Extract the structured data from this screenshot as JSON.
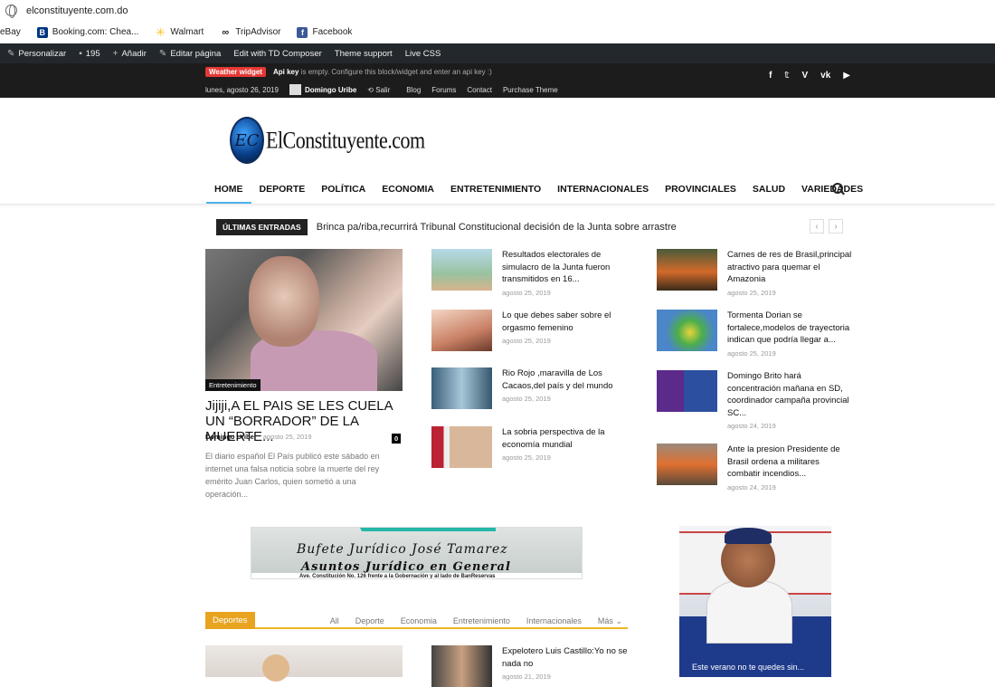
{
  "browser": {
    "url": "elconstituyente.com.do",
    "bookmarks": [
      {
        "label": "eBay",
        "icon": "ebay-icon"
      },
      {
        "label": "Booking.com: Chea...",
        "icon": "booking-icon",
        "color": "#003580"
      },
      {
        "label": "Walmart",
        "icon": "walmart-icon",
        "color": "#ffc220"
      },
      {
        "label": "TripAdvisor",
        "icon": "tripadvisor-icon"
      },
      {
        "label": "Facebook",
        "icon": "facebook-icon",
        "color": "#3b5998"
      }
    ]
  },
  "adminbar": {
    "customize": "Personalizar",
    "comments": "195",
    "add_new": "Añadir",
    "edit_page": "Editar página",
    "td_composer": "Edit with TD Composer",
    "theme_support": "Theme support",
    "live_css": "Live CSS"
  },
  "topbar": {
    "weather_tag": "Weather widget",
    "weather_bold": "Api key",
    "weather_msg": "is empty. Configure this block/widget and enter an api key :)",
    "date": "lunes, agosto 26, 2019",
    "user": "Domingo Uribe",
    "logout": "Salir",
    "menu": [
      "Blog",
      "Forums",
      "Contact",
      "Purchase Theme"
    ],
    "social": [
      "f",
      "t",
      "v",
      "vk",
      "yt"
    ]
  },
  "header": {
    "logo_mark": "EC",
    "logo_text": "ElConstituyente.com",
    "nav": [
      "HOME",
      "DEPORTE",
      "POLÍTICA",
      "ECONOMIA",
      "ENTRETENIMIENTO",
      "INTERNACIONALES",
      "PROVINCIALES",
      "SALUD",
      "VARIEDADES"
    ]
  },
  "ticker": {
    "label": "ÚLTIMAS ENTRADAS",
    "text": "Brinca pa/riba,recurrirá Tribunal Constitucional decisión de la Junta sobre arrastre",
    "prev": "‹",
    "next": "›"
  },
  "feature": {
    "category": "Entretenimiento",
    "title": "Jijiji,A EL PAIS SE LES CUELA UN “BORRADOR” DE LA MUERTE...",
    "author": "Domingo Uribe",
    "date": "agosto 25, 2019",
    "comments": "0",
    "excerpt": "El diario español El País publicó este sábado en internet una falsa noticia sobre la muerte del rey emérito Juan Carlos, quien sometió a una operación..."
  },
  "posts_mid": [
    {
      "title": "Resultados electorales de simulacro de la Junta fueron transmitidos en 16...",
      "date": "agosto 25, 2019"
    },
    {
      "title": "Lo que debes saber sobre el orgasmo femenino",
      "date": "agosto 25, 2019"
    },
    {
      "title": "Rio Rojo ,maravilla de Los Cacaos,del país y del mundo",
      "date": "agosto 25, 2019"
    },
    {
      "title": "La sobria perspectiva de la economía mundial",
      "date": "agosto 25, 2019"
    }
  ],
  "posts_right": [
    {
      "title": "Carnes de res de Brasil,principal atractivo para quemar el Amazonia",
      "date": "agosto 25, 2019"
    },
    {
      "title": "Tormenta Dorian se fortalece,modelos de trayectoria indican que podría llegar a...",
      "date": "agosto 25, 2019"
    },
    {
      "title": "Domingo Brito hará concentración mañana en SD, coordinador campaña provincial SC...",
      "date": "agosto 24, 2019"
    },
    {
      "title": "Ante la presion Presidente de Brasil ordena a militares combatir incendios...",
      "date": "agosto 24, 2019"
    }
  ],
  "ads": {
    "bufete_line1": "Bufete Jurídico José Tamarez",
    "bufete_line2": "Asuntos Jurídico en General",
    "bufete_line3": "Ave. Constitución No. 126 frente a la Gobernación y al lado de BanReservas",
    "side_cta": "Este verano no te quedes sin..."
  },
  "deportes": {
    "head": "Deportes",
    "tabs": [
      "All",
      "Deporte",
      "Economia",
      "Entretenimiento",
      "Internacionales",
      "Más"
    ],
    "post_title": "Expelotero Luis Castillo:Yo no se nada no",
    "post_date": "agosto 21, 2019"
  }
}
